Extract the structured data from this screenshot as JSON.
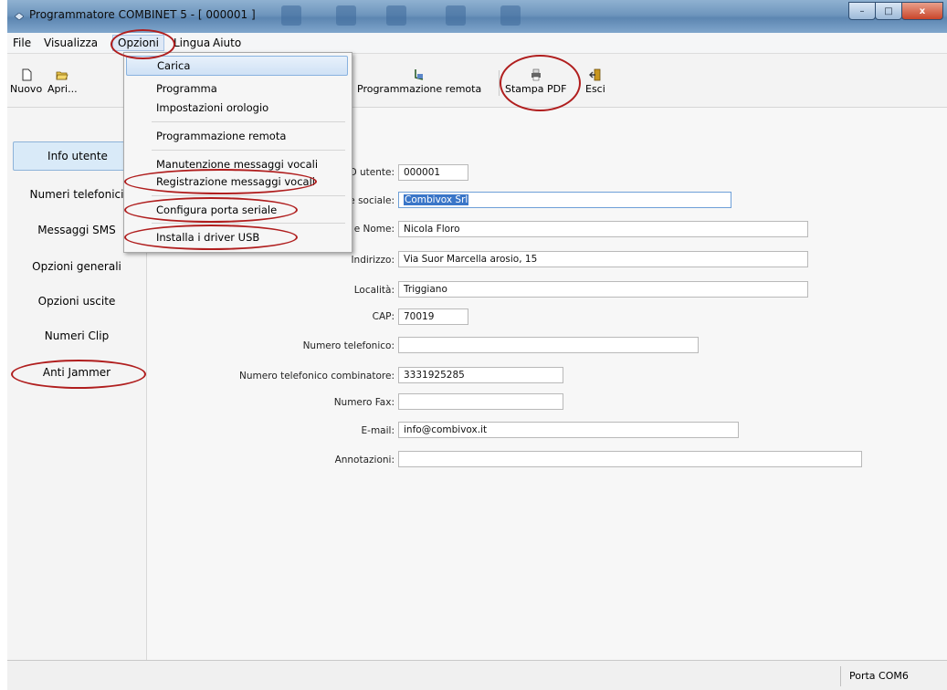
{
  "window": {
    "title": "Programmatore COMBINET 5 - [ 000001 ]",
    "buttons": {
      "minimize": "–",
      "maximize": "□",
      "close": "x"
    }
  },
  "menubar": {
    "file": "File",
    "visualizza": "Visualizza",
    "opzioni": "Opzioni",
    "lingua": "Lingua",
    "aiuto": "Aiuto"
  },
  "toolbar": {
    "nuovo": "Nuovo",
    "apri": "Apri...",
    "programmazione_remota": "Programmazione remota",
    "stampa_pdf": "Stampa PDF",
    "esci": "Esci"
  },
  "options_menu": {
    "carica": "Carica",
    "programma": "Programma",
    "impostazioni_orologio": "Impostazioni orologio",
    "programmazione_remota": "Programmazione remota",
    "manutenzione_messaggi": "Manutenzione messaggi vocali",
    "registrazione_messaggi": "Registrazione messaggi vocali",
    "configura_porta": "Configura porta seriale",
    "installa_driver": "Installa i driver USB"
  },
  "sidebar": {
    "info_utente": "Info utente",
    "numeri_telefonici": "Numeri telefonici",
    "messaggi_sms": "Messaggi SMS",
    "opzioni_generali": "Opzioni generali",
    "opzioni_uscite": "Opzioni uscite",
    "numeri_clip": "Numeri Clip",
    "anti_jammer": "Anti Jammer"
  },
  "form": {
    "id_utente": {
      "label": "ID utente:",
      "value": "000001"
    },
    "ragione_sociale": {
      "label": "e sociale:",
      "value": "Combivox Srl"
    },
    "cognome_nome": {
      "label": "e e Nome:",
      "value": "Nicola Floro"
    },
    "indirizzo": {
      "label": "Indirizzo:",
      "value": "Via Suor Marcella arosio, 15"
    },
    "localita": {
      "label": "Località:",
      "value": "Triggiano"
    },
    "cap": {
      "label": "CAP:",
      "value": "70019"
    },
    "numero_telefonico": {
      "label": "Numero telefonico:",
      "value": ""
    },
    "numero_combinatore": {
      "label": "Numero telefonico combinatore:",
      "value": "3331925285"
    },
    "numero_fax": {
      "label": "Numero Fax:",
      "value": ""
    },
    "email": {
      "label": "E-mail:",
      "value": "info@combivox.it"
    },
    "annotazioni": {
      "label": "Annotazioni:",
      "value": ""
    }
  },
  "statusbar": {
    "port": "Porta COM6"
  },
  "colors": {
    "highlight_oval": "#b01e1e",
    "selection": "#3a76c8",
    "sidebar_active": "#d9eaf8"
  }
}
